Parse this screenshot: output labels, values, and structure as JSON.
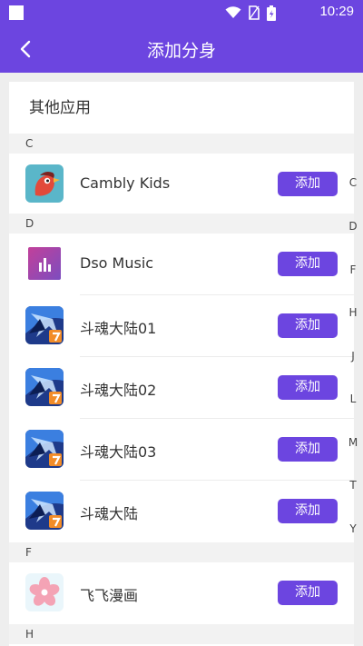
{
  "status": {
    "time": "10:29"
  },
  "appbar": {
    "title": "添加分身"
  },
  "card": {
    "title": "其他应用"
  },
  "sections": [
    {
      "letter": "C"
    },
    {
      "letter": "D"
    },
    {
      "letter": "F"
    },
    {
      "letter": "H"
    }
  ],
  "apps": [
    {
      "name": "Cambly Kids",
      "icon": "cambly-kids-icon",
      "button": "添加"
    },
    {
      "name": "Dso Music",
      "icon": "dso-music-icon",
      "button": "添加"
    },
    {
      "name": "斗魂大陆01",
      "icon": "game-icon",
      "button": "添加"
    },
    {
      "name": "斗魂大陆02",
      "icon": "game-icon",
      "button": "添加"
    },
    {
      "name": "斗魂大陆03",
      "icon": "game-icon",
      "button": "添加"
    },
    {
      "name": "斗魂大陆",
      "icon": "game-icon",
      "button": "添加"
    },
    {
      "name": "飞飞漫画",
      "icon": "sakura-comic-icon",
      "button": "添加"
    }
  ],
  "index_letters": [
    "C",
    "D",
    "F",
    "H",
    "J",
    "L",
    "M",
    "T",
    "Y"
  ],
  "colors": {
    "accent": "#6c45e0"
  }
}
